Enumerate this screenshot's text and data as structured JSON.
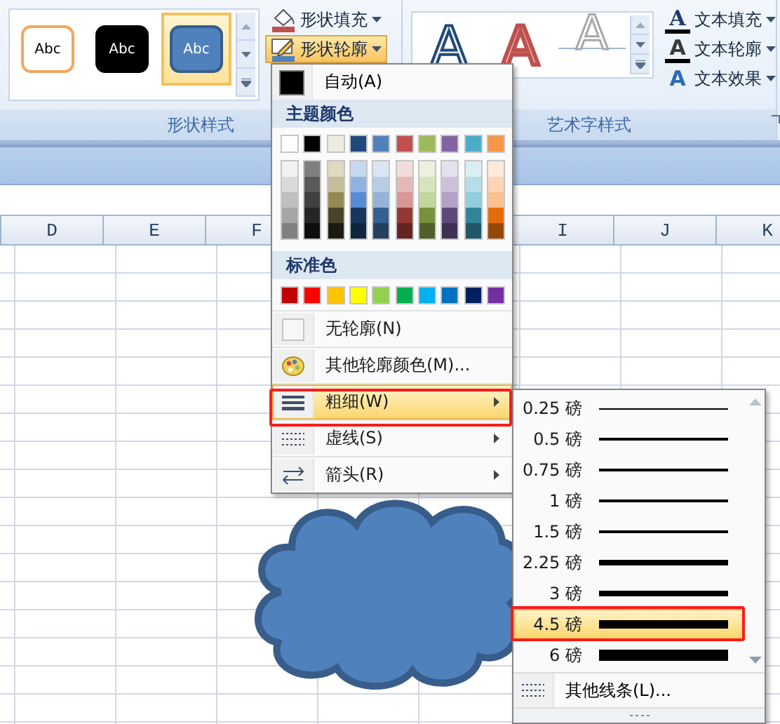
{
  "ribbon": {
    "shape_styles": {
      "label": "形状样式",
      "gallery": [
        {
          "text": "Abc",
          "kind": "outline",
          "selected": false
        },
        {
          "text": "Abc",
          "kind": "dark",
          "selected": false
        },
        {
          "text": "Abc",
          "kind": "blue",
          "selected": true
        }
      ],
      "buttons": [
        {
          "label": "形状填充",
          "kind": "fill",
          "selected": false
        },
        {
          "label": "形状轮廓",
          "kind": "outline",
          "selected": true
        }
      ]
    },
    "wordart_styles": {
      "label": "艺术字样式",
      "gallery": [
        {
          "text": "A",
          "kind": "blue-outline"
        },
        {
          "text": "A",
          "kind": "red-outline"
        },
        {
          "text": "A",
          "kind": "white"
        }
      ],
      "buttons": [
        {
          "label": "文本填充",
          "kind": "fill",
          "icon": "A"
        },
        {
          "label": "文本轮廓",
          "kind": "outline",
          "icon": "A"
        },
        {
          "label": "文本效果",
          "kind": "effect",
          "icon": "A"
        }
      ]
    }
  },
  "sheet": {
    "columns": [
      {
        "label": "D"
      },
      {
        "label": "E"
      },
      {
        "label": "F"
      },
      {
        "label": "I",
        "after_gap": true
      },
      {
        "label": "J"
      },
      {
        "label": "K"
      }
    ]
  },
  "outline_menu": {
    "automatic": "自动(A)",
    "theme_header": "主题颜色",
    "theme_colors": [
      {
        "color": "#ffffff",
        "shades": [
          {
            "color": "#f2f2f2"
          },
          {
            "color": "#d9d9d9"
          },
          {
            "color": "#bfbfbf"
          },
          {
            "color": "#a6a6a6"
          },
          {
            "color": "#808080"
          }
        ]
      },
      {
        "color": "#000000",
        "shades": [
          {
            "color": "#7f7f7f"
          },
          {
            "color": "#595959"
          },
          {
            "color": "#404040"
          },
          {
            "color": "#262626"
          },
          {
            "color": "#0d0d0d"
          }
        ]
      },
      {
        "color": "#eeece1",
        "shades": [
          {
            "color": "#ddd9c3"
          },
          {
            "color": "#c4bd97"
          },
          {
            "color": "#938953"
          },
          {
            "color": "#494429"
          },
          {
            "color": "#1d1b10"
          }
        ]
      },
      {
        "color": "#1f497d",
        "shades": [
          {
            "color": "#c6d9f0"
          },
          {
            "color": "#8db3e2"
          },
          {
            "color": "#548dd4"
          },
          {
            "color": "#17365d"
          },
          {
            "color": "#0f243e"
          }
        ]
      },
      {
        "color": "#4f81bd",
        "shades": [
          {
            "color": "#dbe5f1"
          },
          {
            "color": "#b8cce4"
          },
          {
            "color": "#95b3d7"
          },
          {
            "color": "#366092"
          },
          {
            "color": "#244061"
          }
        ]
      },
      {
        "color": "#c0504d",
        "shades": [
          {
            "color": "#f2dcdb"
          },
          {
            "color": "#e5b9b7"
          },
          {
            "color": "#d99694"
          },
          {
            "color": "#953734"
          },
          {
            "color": "#632423"
          }
        ]
      },
      {
        "color": "#9bbb59",
        "shades": [
          {
            "color": "#ebf1dd"
          },
          {
            "color": "#d7e3bc"
          },
          {
            "color": "#c3d69b"
          },
          {
            "color": "#76923c"
          },
          {
            "color": "#4f6128"
          }
        ]
      },
      {
        "color": "#8064a2",
        "shades": [
          {
            "color": "#e5e0ec"
          },
          {
            "color": "#ccc1d9"
          },
          {
            "color": "#b2a2c7"
          },
          {
            "color": "#5f497a"
          },
          {
            "color": "#3f3151"
          }
        ]
      },
      {
        "color": "#4bacc6",
        "shades": [
          {
            "color": "#dbeef3"
          },
          {
            "color": "#b7dde8"
          },
          {
            "color": "#92cddc"
          },
          {
            "color": "#31859b"
          },
          {
            "color": "#205867"
          }
        ]
      },
      {
        "color": "#f79646",
        "shades": [
          {
            "color": "#fdeada"
          },
          {
            "color": "#fbd5b5"
          },
          {
            "color": "#fac08f"
          },
          {
            "color": "#e36c09"
          },
          {
            "color": "#974806"
          }
        ]
      }
    ],
    "standard_header": "标准色",
    "standard_colors": [
      {
        "color": "#c00000"
      },
      {
        "color": "#ff0000"
      },
      {
        "color": "#ffc000"
      },
      {
        "color": "#ffff00"
      },
      {
        "color": "#92d050"
      },
      {
        "color": "#00b050"
      },
      {
        "color": "#00b0f0"
      },
      {
        "color": "#0070c0"
      },
      {
        "color": "#002060"
      },
      {
        "color": "#7030a0"
      }
    ],
    "items": [
      {
        "label": "无轮廓(N)",
        "kind": "no-outline",
        "selected": false,
        "submenu": false
      },
      {
        "label": "其他轮廓颜色(M)...",
        "kind": "palette",
        "selected": false,
        "submenu": false
      },
      {
        "label": "粗细(W)",
        "kind": "weight",
        "selected": true,
        "submenu": true
      },
      {
        "label": "虚线(S)",
        "kind": "dash",
        "selected": false,
        "submenu": true
      },
      {
        "label": "箭头(R)",
        "kind": "arrow",
        "selected": false,
        "submenu": true
      }
    ]
  },
  "weight_menu": {
    "items": [
      {
        "label": "0.25 磅",
        "selected": false
      },
      {
        "label": "0.5 磅",
        "selected": false
      },
      {
        "label": "0.75 磅",
        "selected": false
      },
      {
        "label": "1 磅",
        "selected": false
      },
      {
        "label": "1.5 磅",
        "selected": false
      },
      {
        "label": "2.25 磅",
        "selected": false
      },
      {
        "label": "3 磅",
        "selected": false
      },
      {
        "label": "4.5 磅",
        "selected": true
      },
      {
        "label": "6 磅",
        "selected": false
      }
    ],
    "more": "其他线条(L)..."
  }
}
